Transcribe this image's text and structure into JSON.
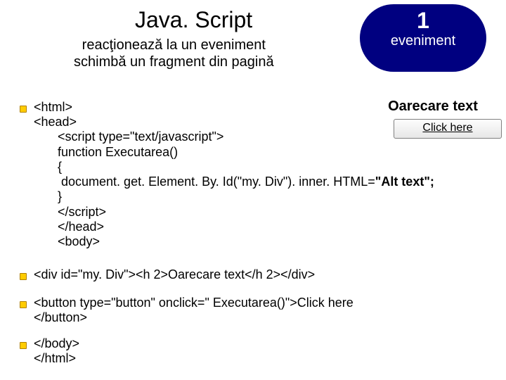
{
  "title": "Java. Script",
  "subtitle_line1": "reacţionează la un eveniment",
  "subtitle_line2": "schimbă un fragment din pagină",
  "badge": {
    "num": "1",
    "label": "eveniment"
  },
  "example": {
    "heading": "Oarecare text",
    "button": "Click here"
  },
  "code": {
    "l1": "<html>",
    "l2": "<head>",
    "l3a": "<script type=\"text/javascript\">",
    "l4": "function Executarea()",
    "l5": "{",
    "l6a": " document. get. Element. By. Id(\"my. Div\"). inner. HTML=",
    "l6b": "\"Alt text\";",
    "l7": "}",
    "l8": "</scr",
    "l8b": "ipt>",
    "l9": "</head>",
    "l10": "<body>"
  },
  "code2a": "<div id=\"my. Div\"><h 2>",
  "code2b": "Oarecare text",
  "code2c": "</h 2></div>",
  "code3a": "<button type=\"button\" onclick=\" Executarea()\">Click here",
  "code3b": "</button>",
  "code4a": "</body>",
  "code4b": "</html>"
}
